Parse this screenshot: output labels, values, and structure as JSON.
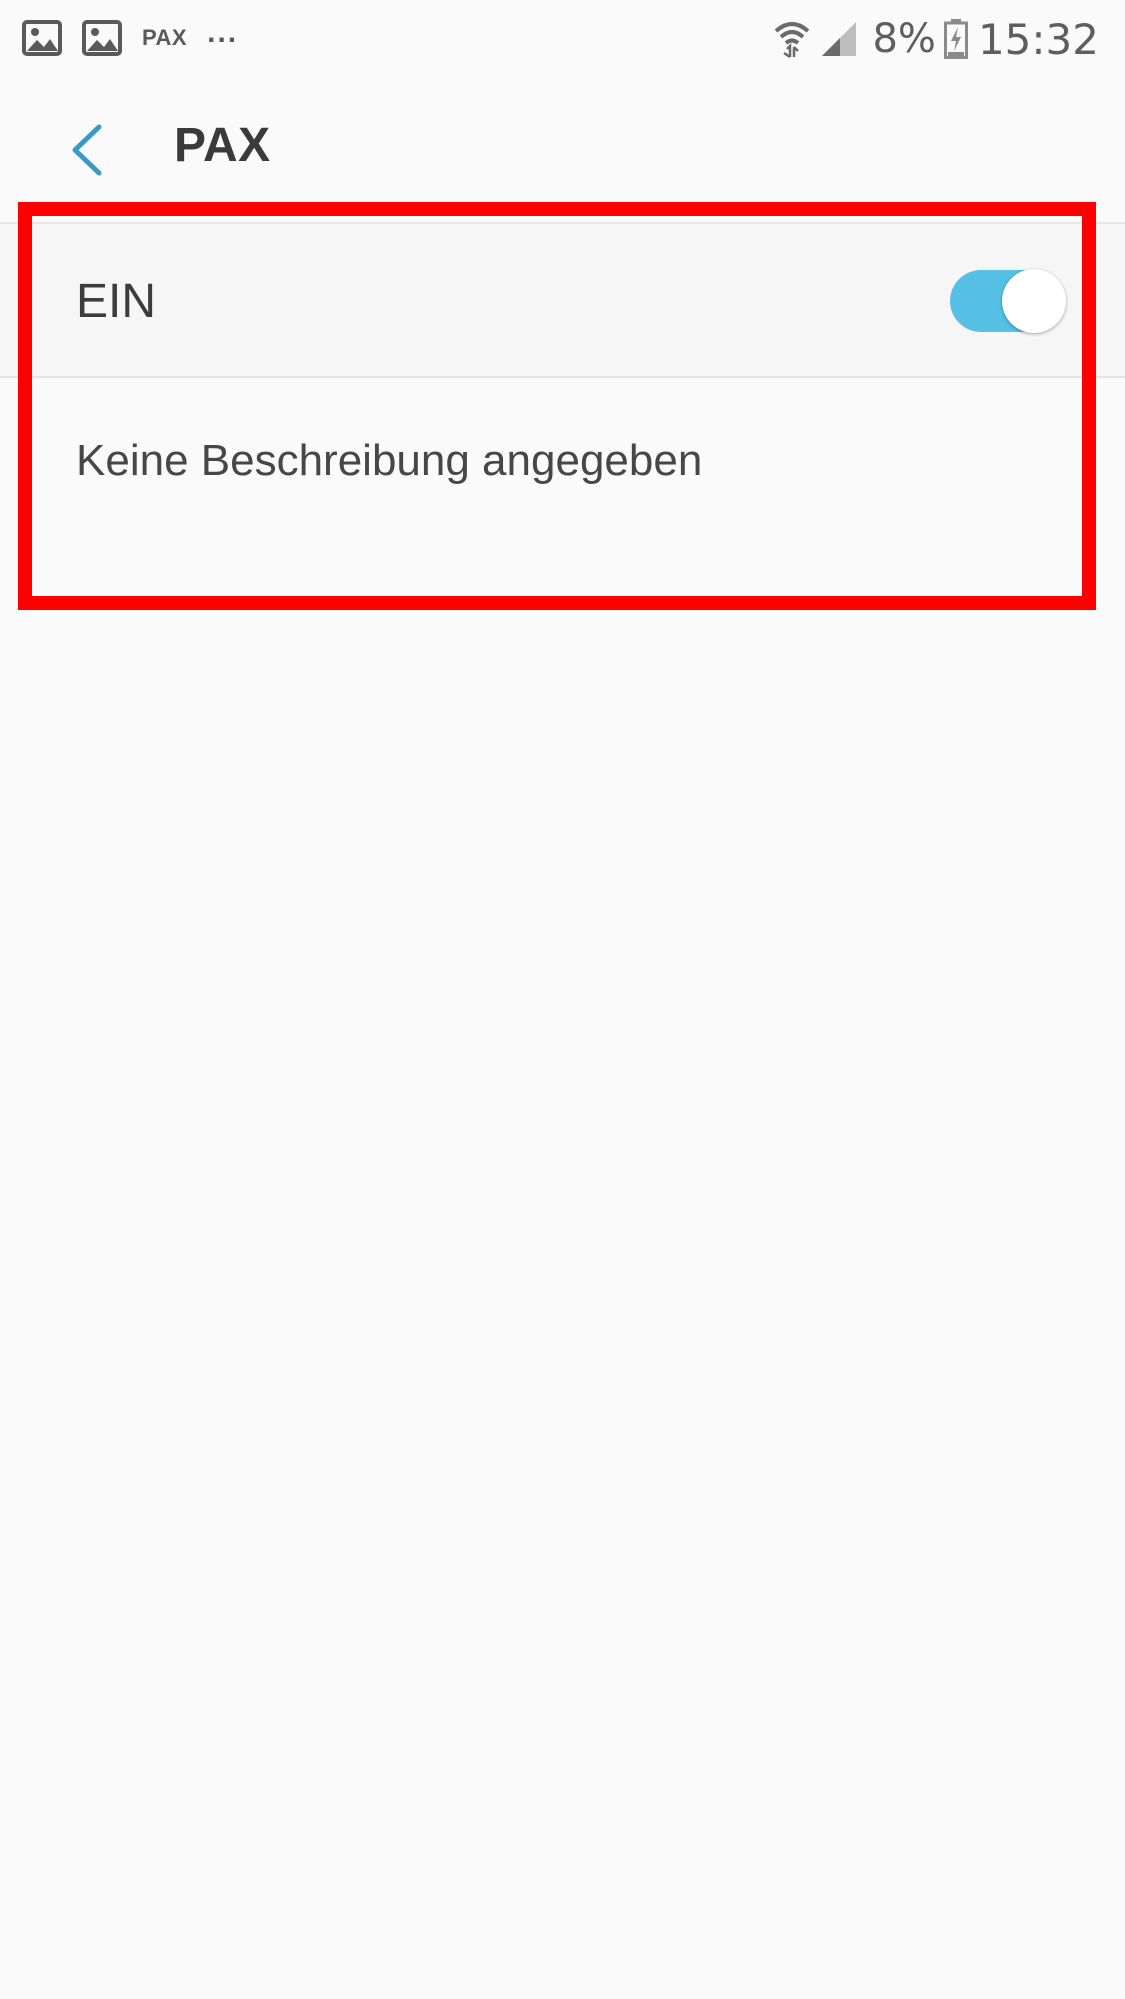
{
  "status_bar": {
    "app_label": "PAX",
    "more": "...",
    "battery_percent": "8%",
    "time": "15:32",
    "icons": [
      "image-icon",
      "image-icon",
      "wifi-icon",
      "signal-icon",
      "battery-charging-icon"
    ]
  },
  "header": {
    "back_icon": "chevron-left-icon",
    "title": "PAX"
  },
  "setting": {
    "toggle_label": "EIN",
    "toggle_state": "on",
    "description": "Keine Beschreibung angegeben"
  },
  "colors": {
    "accent": "#56c0e4",
    "back_arrow": "#3b9ac4",
    "highlight": "#ff0000",
    "background": "#fafafa"
  }
}
